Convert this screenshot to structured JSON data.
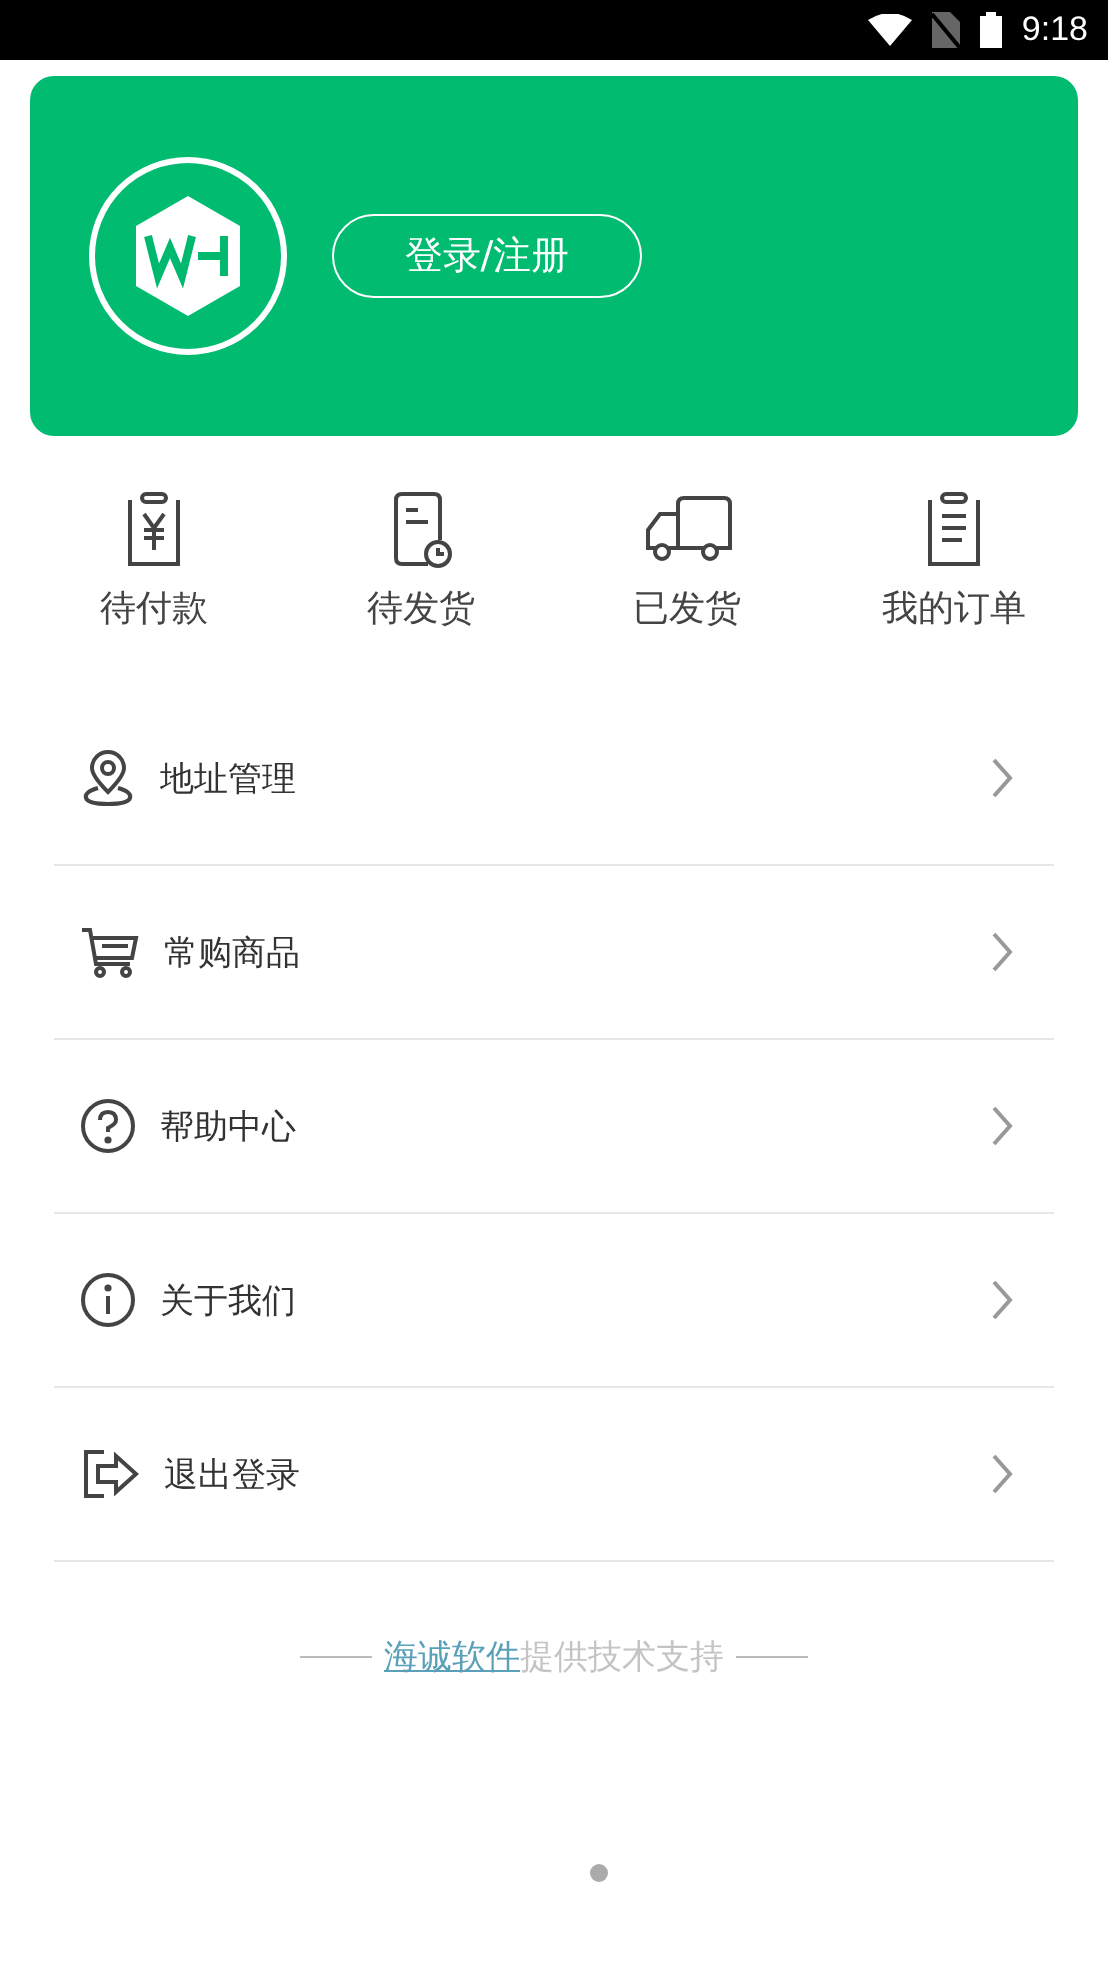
{
  "status_bar": {
    "time": "9:18"
  },
  "profile": {
    "login_button": "登录/注册"
  },
  "orders": [
    {
      "kind": "payment",
      "label": "待付款"
    },
    {
      "kind": "pending",
      "label": "待发货"
    },
    {
      "kind": "shipped",
      "label": "已发货"
    },
    {
      "kind": "list",
      "label": "我的订单"
    }
  ],
  "menu": [
    {
      "kind": "location",
      "label": "地址管理"
    },
    {
      "kind": "cart",
      "label": "常购商品"
    },
    {
      "kind": "help",
      "label": "帮助中心"
    },
    {
      "kind": "info",
      "label": "关于我们"
    },
    {
      "kind": "logout",
      "label": "退出登录"
    }
  ],
  "footer": {
    "link": "海诚软件",
    "text": "提供技术支持"
  }
}
